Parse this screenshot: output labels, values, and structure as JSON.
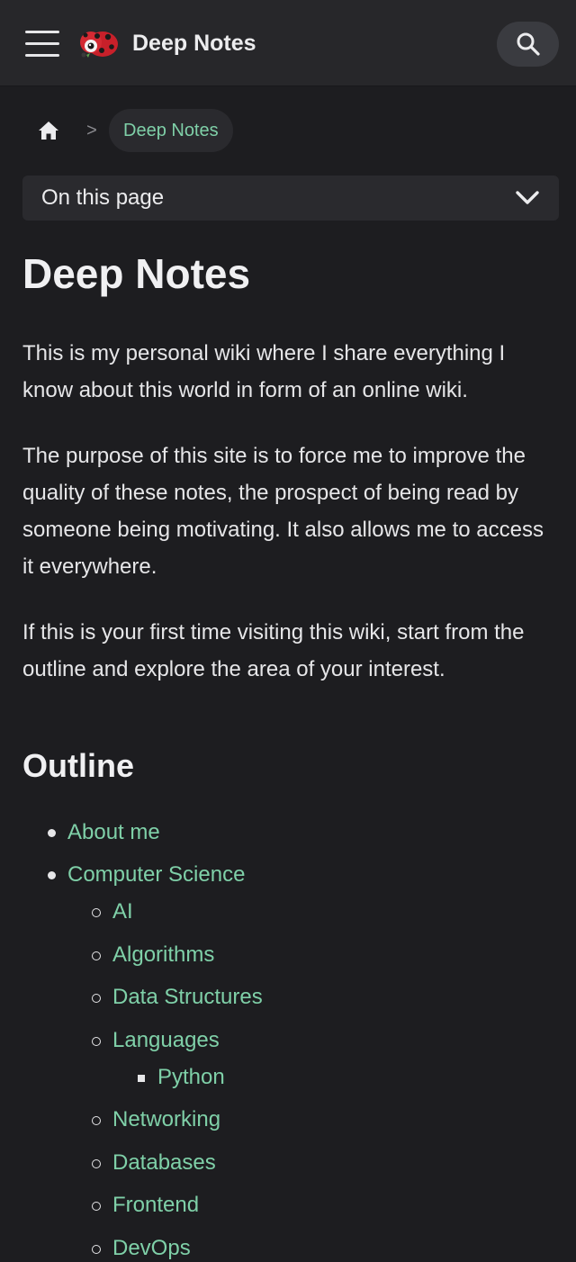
{
  "header": {
    "site_title": "Deep Notes",
    "menu_icon": "hamburger-menu-icon",
    "logo": "ladybug-logo",
    "search_icon": "search-icon"
  },
  "breadcrumb": {
    "home_icon": "home-icon",
    "separator": ">",
    "current": "Deep Notes"
  },
  "toc": {
    "label": "On this page",
    "chevron_icon": "chevron-down-icon"
  },
  "page": {
    "title": "Deep Notes",
    "paragraphs": [
      "This is my personal wiki where I share everything I know about this world in form of an online wiki.",
      "The purpose of this site is to force me to improve the quality of these notes, the prospect of being read by someone being motivating. It also allows me to access it everywhere.",
      "If this is your first time visiting this wiki, start from the outline and explore the area of your interest."
    ]
  },
  "outline": {
    "heading": "Outline",
    "items": [
      "About me",
      "Computer Science",
      "AI",
      "Algorithms",
      "Data Structures",
      "Languages",
      "Python",
      "Networking",
      "Databases",
      "Frontend",
      "DevOps"
    ]
  },
  "colors": {
    "background": "#1d1d20",
    "header": "#27272a",
    "link": "#7fd0a8",
    "text": "#e6e6e8"
  }
}
